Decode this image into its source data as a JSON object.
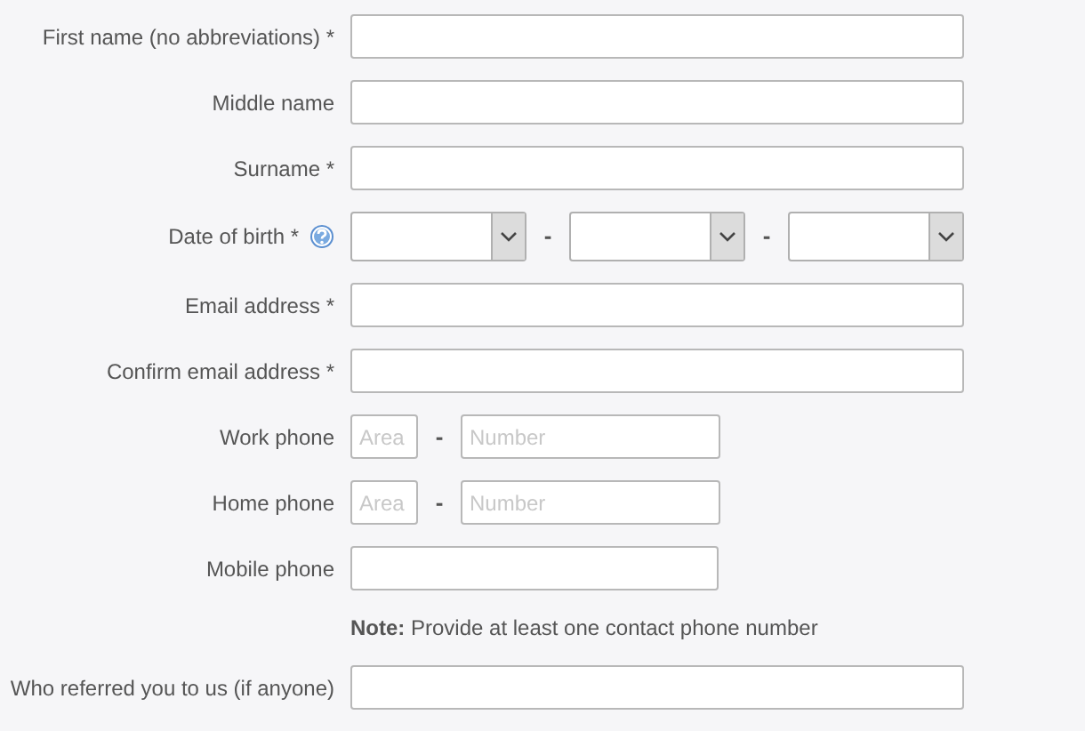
{
  "fields": [
    {
      "kind": "text",
      "label": "First name (no abbreviations) *"
    },
    {
      "kind": "text",
      "label": "Middle name"
    },
    {
      "kind": "text",
      "label": "Surname *"
    },
    {
      "kind": "date",
      "label": "Date of birth *",
      "help": true,
      "separator": "-"
    },
    {
      "kind": "text",
      "label": "Email address *"
    },
    {
      "kind": "text",
      "label": "Confirm email address *"
    },
    {
      "kind": "phone",
      "label": "Work phone",
      "area_placeholder": "Area",
      "separator": "-",
      "number_placeholder": "Number"
    },
    {
      "kind": "phone",
      "label": "Home phone",
      "area_placeholder": "Area",
      "separator": "-",
      "number_placeholder": "Number"
    },
    {
      "kind": "shorttext",
      "label": "Mobile phone"
    },
    {
      "kind": "note",
      "text": "**Note:** Provide at least one contact phone number"
    },
    {
      "kind": "text",
      "label": "Who referred you to us (if anyone)"
    }
  ]
}
